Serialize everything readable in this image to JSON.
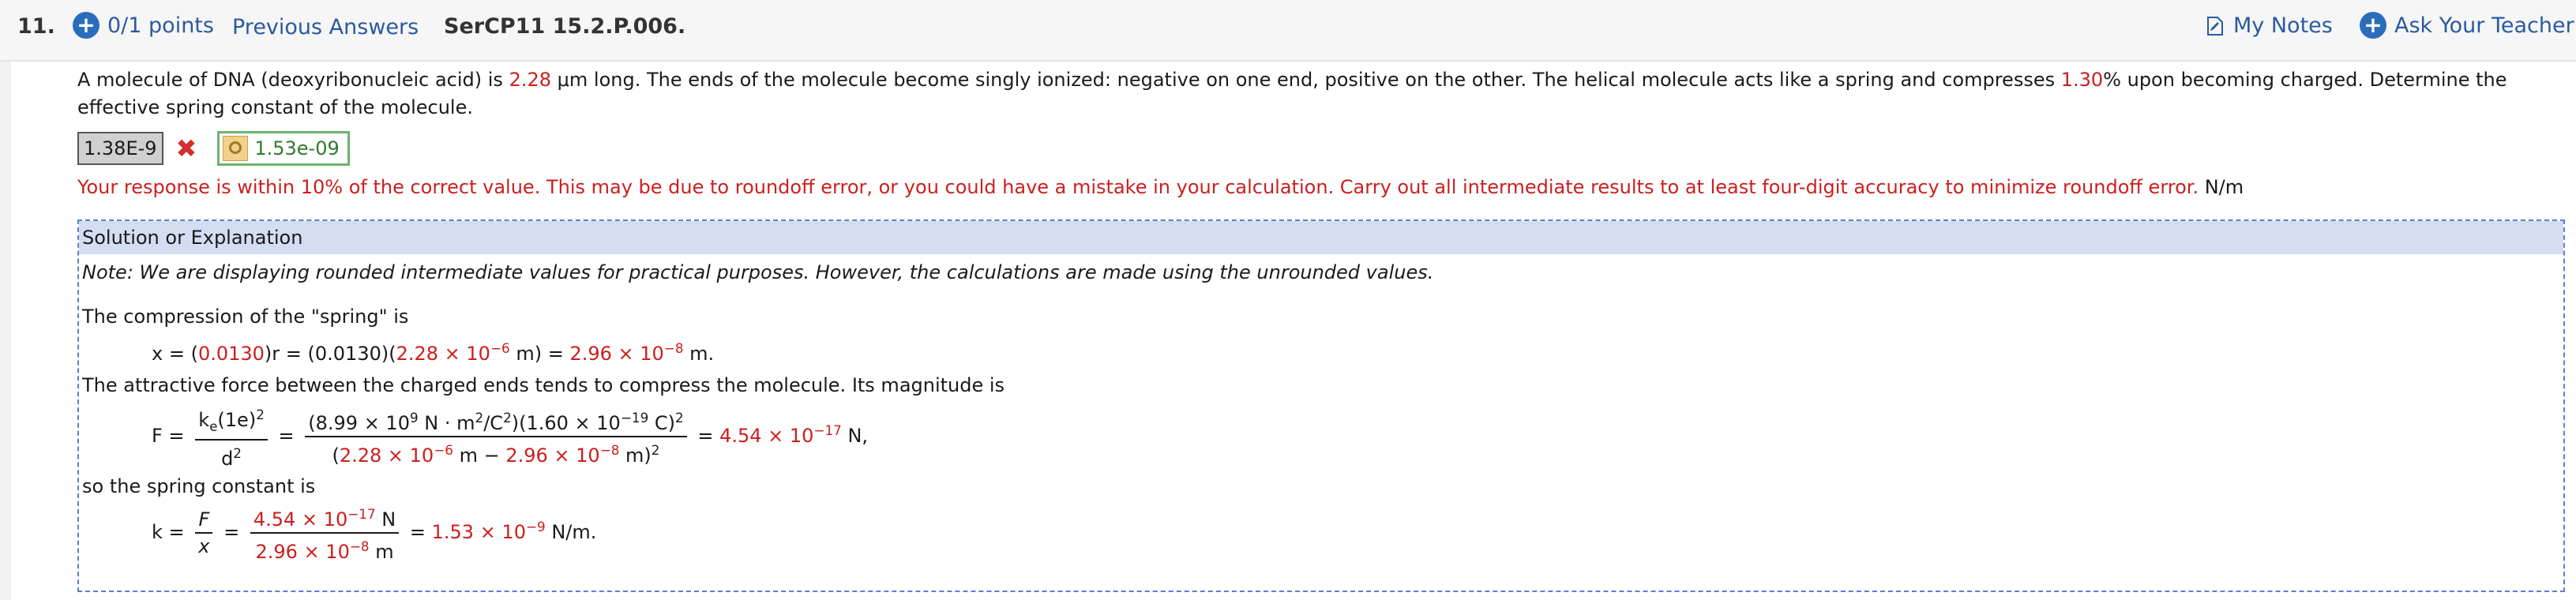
{
  "header": {
    "question_number": "11.",
    "points": "0/1 points",
    "previous_answers": "Previous Answers",
    "problem_code": "SerCP11 15.2.P.006.",
    "my_notes": "My Notes",
    "ask_teacher": "Ask Your Teacher"
  },
  "question": {
    "text_1": "A molecule of DNA (deoxyribonucleic acid) is ",
    "length": "2.28",
    "text_2": " μm long. The ends of the molecule become singly ionized: negative on one end, positive on the other. The helical molecule acts like a spring and compresses ",
    "compression_percent": "1.30",
    "text_3": "% upon becoming charged. Determine the effective spring constant of the molecule."
  },
  "answer": {
    "submitted": "1.38E-9",
    "correct": "1.53e-09",
    "feedback": "Your response is within 10% of the correct value. This may be due to roundoff error, or you could have a mistake in your calculation. Carry out all intermediate results to at least four-digit accuracy to minimize roundoff error.",
    "unit": "N/m"
  },
  "solution": {
    "header": "Solution or Explanation",
    "note": "Note: We are displaying rounded intermediate values for practical purposes. However, the calculations are made using the unrounded values.",
    "line_compression": "The compression of the \"spring\" is",
    "line_force": "The attractive force between the charged ends tends to compress the molecule. Its magnitude is",
    "line_spring": "so the spring constant is",
    "eq_x": {
      "lhs": "x = (",
      "frac1": "0.0130",
      "mid": ")r = (0.0130)(",
      "r_val": "2.28 × 10",
      "r_exp": "−6",
      "r_unit": " m) = ",
      "x_val": "2.96 × 10",
      "x_exp": "−8",
      "x_unit": " m."
    },
    "eq_F": {
      "lhs": "F =",
      "num1": "k",
      "num1_sub": "e",
      "num1_rest": "(1e)",
      "num1_pow": "2",
      "den1": "d",
      "den1_pow": "2",
      "num2_a": "(8.99 × 10",
      "num2_a_exp": "9",
      "num2_b": " N · m",
      "num2_b_exp": "2",
      "num2_c": "/C",
      "num2_c_exp": "2",
      "num2_d": ")(1.60 × 10",
      "num2_d_exp": "−19",
      "num2_e": " C)",
      "num2_e_exp": "2",
      "den2_open": "(",
      "den2_a": "2.28 × 10",
      "den2_a_exp": "−6",
      "den2_mid": " m − ",
      "den2_b": "2.96 × 10",
      "den2_b_exp": "−8",
      "den2_close": " m)",
      "den2_pow": "2",
      "result": "4.54 × 10",
      "result_exp": "−17",
      "result_unit": " N,"
    },
    "eq_k": {
      "lhs": "k =",
      "f_num": "F",
      "f_den": "x",
      "num": "4.54 × 10",
      "num_exp": "−17",
      "num_unit": " N",
      "den": "2.96 × 10",
      "den_exp": "−8",
      "den_unit": " m",
      "result": "1.53 × 10",
      "result_exp": "−9",
      "result_unit": " N/m."
    }
  },
  "colors": {
    "link_blue": "#2a5aa0",
    "value_red": "#cc1f1f",
    "correct_green": "#2f7a2f",
    "solution_header_bg": "#d4ddf2"
  }
}
